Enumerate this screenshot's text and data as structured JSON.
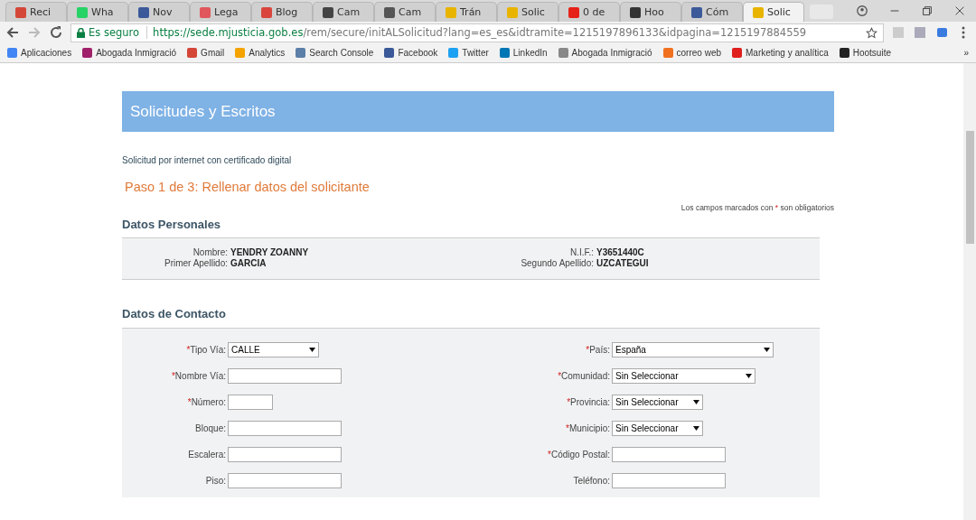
{
  "tabs": [
    {
      "label": "Reci",
      "color": "#d44638",
      "selected": false
    },
    {
      "label": "Wha",
      "color": "#25d366",
      "selected": false
    },
    {
      "label": "Nov",
      "color": "#3c5a9a",
      "selected": false
    },
    {
      "label": "Lega",
      "color": "#e0565b",
      "selected": false
    },
    {
      "label": "Blog",
      "color": "#d9453d",
      "selected": false
    },
    {
      "label": "Cam",
      "color": "#444444",
      "selected": false
    },
    {
      "label": "Cam",
      "color": "#555555",
      "selected": false
    },
    {
      "label": "Trán",
      "color": "#e8b400",
      "selected": false
    },
    {
      "label": "Solic",
      "color": "#e8b400",
      "selected": false
    },
    {
      "label": "0 de",
      "color": "#e62117",
      "selected": false
    },
    {
      "label": "Hoo",
      "color": "#333333",
      "selected": false
    },
    {
      "label": "Cóm",
      "color": "#3c5a9a",
      "selected": false
    },
    {
      "label": "Solic",
      "color": "#e8b400",
      "selected": true
    }
  ],
  "address": {
    "security": "Es seguro",
    "host": "https://sede.mjusticia.gob.es",
    "path": "/rem/secure/initALSolicitud?lang=es_es&idtramite=1215197896133&idpagina=1215197884559"
  },
  "bookmarks": [
    {
      "label": "Aplicaciones",
      "color": "#4285f4"
    },
    {
      "label": "Abogada Inmigració",
      "color": "#a0206a"
    },
    {
      "label": "Gmail",
      "color": "#d44638"
    },
    {
      "label": "Analytics",
      "color": "#f4a300"
    },
    {
      "label": "Search Console",
      "color": "#5b7fa8"
    },
    {
      "label": "Facebook",
      "color": "#3b5998"
    },
    {
      "label": "Twitter",
      "color": "#1da1f2"
    },
    {
      "label": "LinkedIn",
      "color": "#0077b5"
    },
    {
      "label": "Abogada Inmigració",
      "color": "#888888"
    },
    {
      "label": "correo web",
      "color": "#f07020"
    },
    {
      "label": "Marketing y analítica",
      "color": "#e01e1e"
    },
    {
      "label": "Hootsuite",
      "color": "#222222"
    }
  ],
  "bookmarks_more": "»",
  "page": {
    "banner": "Solicitudes y Escritos",
    "subtitle": "Solicitud por internet con certificado digital",
    "step": "Paso 1 de 3: Rellenar datos del solicitante",
    "note_before": "Los campos marcados con",
    "note_mark": "*",
    "note_after": "son obligatorios",
    "personal": {
      "title": "Datos Personales",
      "fields": [
        {
          "label": "Nombre:",
          "value": "YENDRY ZOANNY"
        },
        {
          "label": "N.I.F.:",
          "value": "Y3651440C"
        },
        {
          "label": "Primer Apellido:",
          "value": "GARCIA"
        },
        {
          "label": "Segundo Apellido:",
          "value": "UZCATEGUI"
        }
      ]
    },
    "contact": {
      "title": "Datos de Contacto",
      "fields": [
        {
          "label": "Tipo Vía:",
          "required": true,
          "kind": "select",
          "value": "CALLE"
        },
        {
          "label": "País:",
          "required": true,
          "kind": "select",
          "value": "España"
        },
        {
          "label": "Nombre Vía:",
          "required": true,
          "kind": "text"
        },
        {
          "label": "Comunidad:",
          "required": true,
          "kind": "select",
          "value": "Sin Seleccionar"
        },
        {
          "label": "Número:",
          "required": true,
          "kind": "text"
        },
        {
          "label": "Provincia:",
          "required": true,
          "kind": "select",
          "value": "Sin Seleccionar"
        },
        {
          "label": "Bloque:",
          "required": false,
          "kind": "text"
        },
        {
          "label": "Municipio:",
          "required": true,
          "kind": "select",
          "value": "Sin Seleccionar"
        },
        {
          "label": "Escalera:",
          "required": false,
          "kind": "text"
        },
        {
          "label": "Código Postal:",
          "required": true,
          "kind": "text"
        },
        {
          "label": "Piso:",
          "required": false,
          "kind": "text"
        },
        {
          "label": "Teléfono:",
          "required": false,
          "kind": "text"
        }
      ]
    }
  }
}
